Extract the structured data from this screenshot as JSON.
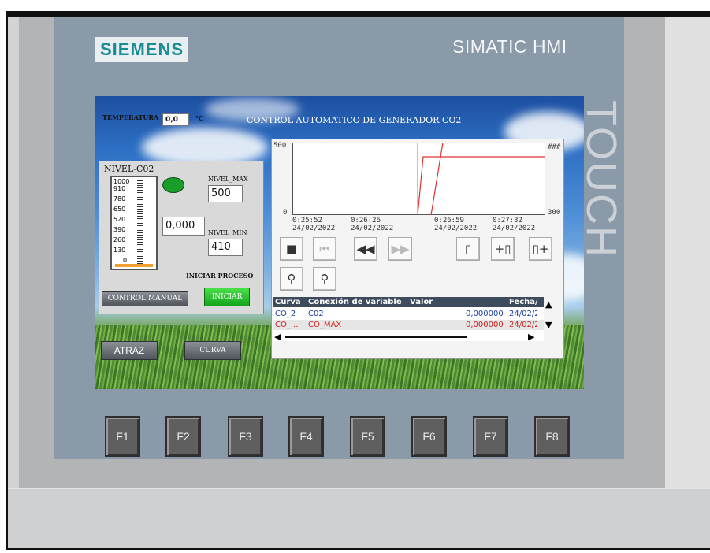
{
  "device": {
    "brand": "SIEMENS",
    "model": "SIMATIC HMI",
    "side_label": "TOUCH"
  },
  "screen": {
    "title": "CONTROL AUTOMATICO DE GENERADOR CO2",
    "temperatura": {
      "label": "TEMPERATURA",
      "value": "0,0",
      "unit": "°C"
    },
    "panel": {
      "title": "NIVEL-C02",
      "scale": [
        "1000",
        "910",
        "780",
        "650",
        "520",
        "390",
        "260",
        "130",
        "0"
      ],
      "level_value": "0,000",
      "nivel_max_label": "NIVEL_MAX",
      "nivel_max_value": "500",
      "nivel_min_label": "NIVEL_MIN",
      "nivel_min_value": "410",
      "iniciar_proceso_label": "INICIAR PROCESO",
      "control_manual_label": "CONTROL MANUAL",
      "iniciar_label": "INICIAR",
      "indicator_color": "#1a9e2a"
    },
    "atraz_label": "ATRAZ",
    "curva_label": "CURVA",
    "trend": {
      "y_left_top": "500",
      "y_left_bottom": "0",
      "y_right_top": "###",
      "y_right_bottom": "300",
      "x_ticks": [
        {
          "time": "0:25:52",
          "date": "24/02/2022"
        },
        {
          "time": "0:26:26",
          "date": "24/02/2022"
        },
        {
          "time": "0:26:59",
          "date": "24/02/2022"
        },
        {
          "time": "0:27:32",
          "date": "24/02/2022"
        }
      ],
      "toolbar": [
        "stop",
        "first",
        "rewind",
        "forward",
        "ruler",
        "ruler-back",
        "ruler-forward",
        "zoom-in",
        "zoom-out"
      ],
      "table": {
        "headers": [
          "Curva",
          "Conexión de variable",
          "Valor",
          "Fecha/"
        ],
        "rows": [
          {
            "curva": "CO_2",
            "conexion": "C02",
            "valor": "0,000000",
            "fecha": "24/02/2",
            "color": "#1c3fa8"
          },
          {
            "curva": "CO_...",
            "conexion": "CO_MAX",
            "valor": "0,000000",
            "fecha": "24/02/2",
            "color": "#d02020"
          }
        ]
      },
      "series_color": "#e03030"
    }
  },
  "function_keys": [
    "F1",
    "F2",
    "F3",
    "F4",
    "F5",
    "F6",
    "F7",
    "F8"
  ]
}
